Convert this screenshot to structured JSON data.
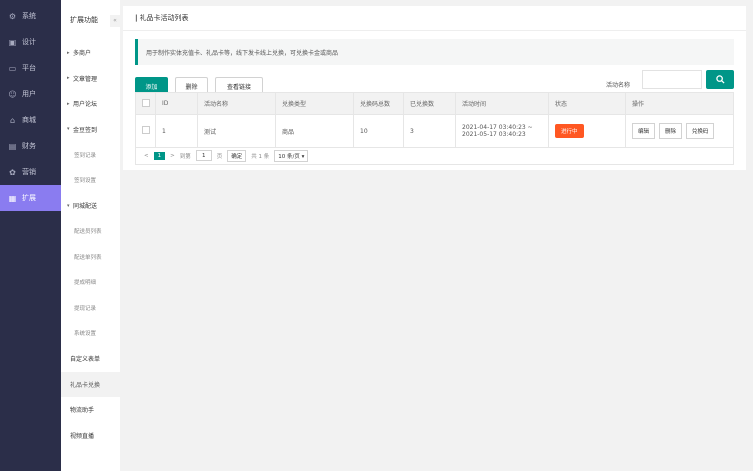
{
  "nav1": [
    {
      "label": "系统",
      "icon": "gear-icon"
    },
    {
      "label": "设计",
      "icon": "design-icon"
    },
    {
      "label": "平台",
      "icon": "monitor-icon"
    },
    {
      "label": "用户",
      "icon": "user-icon"
    },
    {
      "label": "商城",
      "icon": "shop-icon"
    },
    {
      "label": "财务",
      "icon": "finance-icon"
    },
    {
      "label": "营销",
      "icon": "marketing-icon"
    },
    {
      "label": "扩展",
      "icon": "grid-icon"
    }
  ],
  "nav2": {
    "title": "扩展功能",
    "collapse": "«",
    "items": [
      {
        "label": "多商户",
        "type": "group"
      },
      {
        "label": "文章管理",
        "type": "group"
      },
      {
        "label": "用户论坛",
        "type": "group"
      },
      {
        "label": "金豆签到",
        "type": "open"
      },
      {
        "label": "签到记录",
        "type": "sub"
      },
      {
        "label": "签到设置",
        "type": "sub"
      },
      {
        "label": "同城配送",
        "type": "open"
      },
      {
        "label": "配送员列表",
        "type": "sub"
      },
      {
        "label": "配送单列表",
        "type": "sub"
      },
      {
        "label": "提成明细",
        "type": "sub"
      },
      {
        "label": "提现记录",
        "type": "sub"
      },
      {
        "label": "系统设置",
        "type": "sub"
      },
      {
        "label": "自定义表单",
        "type": "plain"
      },
      {
        "label": "礼品卡兑换",
        "type": "current"
      },
      {
        "label": "物流助手",
        "type": "plain"
      },
      {
        "label": "视频直播",
        "type": "plain"
      }
    ]
  },
  "panel": {
    "title_mark": "|",
    "title": "礼品卡活动列表",
    "tip": "用于制作实体充值卡、礼品卡等，线下发卡线上兑换，可兑换卡金或商品",
    "add": "添加",
    "delete": "删除",
    "view_link": "查看链接",
    "search_label": "活动名称",
    "search_value": "",
    "search_icon": "search-icon"
  },
  "table": {
    "headers": [
      "ID",
      "活动名称",
      "兑换类型",
      "兑换码总数",
      "已兑换数",
      "活动时间",
      "状态",
      "操作"
    ],
    "rows": [
      {
        "id": "1",
        "name": "测试",
        "type": "商品",
        "total": "10",
        "used": "3",
        "time1": "2021-04-17 03:40:23 ~",
        "time2": "2021-05-17 03:40:23",
        "status": "进行中",
        "op_edit": "编辑",
        "op_delete": "删除",
        "op_code": "兑换码"
      }
    ]
  },
  "pager": {
    "prev": "<",
    "page": "1",
    "next": ">",
    "goto": "到第",
    "goto_value": "1",
    "page_unit": "页",
    "go": "确定",
    "total": "共 1 条",
    "size": "10 条/页 ▾"
  },
  "colors": {
    "accent": "#009688",
    "sidebar": "#2b2e49",
    "active": "#8a7cf0",
    "status": "#ff5722"
  }
}
